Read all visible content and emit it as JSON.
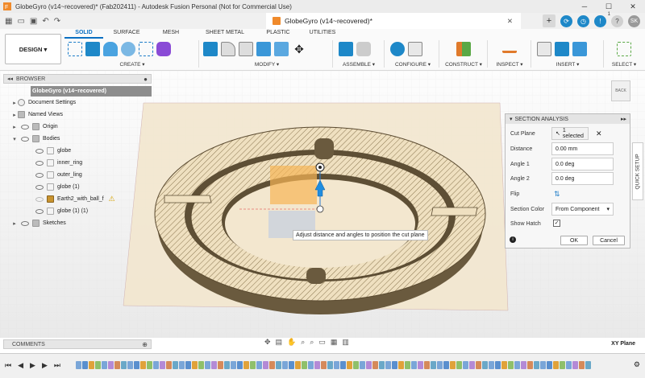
{
  "window": {
    "title": "GlobeGyro (v14~recovered)* (Fab202411) - Autodesk Fusion Personal (Not for Commercial Use)",
    "controls": [
      "─",
      "☐",
      "✕"
    ]
  },
  "doc_tab": {
    "title": "GlobeGyro (v14~recovered)*",
    "close": "✕",
    "add": "+"
  },
  "user": {
    "initials": "SK"
  },
  "notification_count": "1",
  "workspace_button": "DESIGN ▾",
  "ws_tabs": [
    "SOLID",
    "SURFACE",
    "MESH",
    "SHEET METAL",
    "PLASTIC",
    "UTILITIES"
  ],
  "tool_groups": [
    {
      "label": "CREATE ▾"
    },
    {
      "label": "MODIFY ▾"
    },
    {
      "label": "ASSEMBLE ▾"
    },
    {
      "label": "CONFIGURE ▾"
    },
    {
      "label": "CONSTRUCT ▾"
    },
    {
      "label": "INSPECT ▾"
    },
    {
      "label": "INSERT ▾"
    },
    {
      "label": "SELECT ▾"
    }
  ],
  "browser": {
    "header": "BROWSER",
    "root": "GlobeGyro (v14~recovered)",
    "items": [
      {
        "label": "Document Settings"
      },
      {
        "label": "Named Views"
      },
      {
        "label": "Origin"
      },
      {
        "label": "Bodies"
      },
      {
        "label": "globe"
      },
      {
        "label": "inner_ring"
      },
      {
        "label": "outer_ling"
      },
      {
        "label": "globe (1)"
      },
      {
        "label": "Earth2_with_ball_f"
      },
      {
        "label": "globe (1) (1)"
      },
      {
        "label": "Sketches"
      }
    ]
  },
  "section_analysis": {
    "title": "SECTION ANALYSIS",
    "cut_plane_label": "Cut Plane",
    "cut_plane_value": "1 selected",
    "distance_label": "Distance",
    "distance_value": "0.00 mm",
    "angle1_label": "Angle 1",
    "angle1_value": "0.0 deg",
    "angle2_label": "Angle 2",
    "angle2_value": "0.0 deg",
    "flip_label": "Flip",
    "color_label": "Section Color",
    "color_value": "From Component",
    "hatch_label": "Show Hatch",
    "hatch_checked": "✓",
    "ok": "OK",
    "cancel": "Cancel"
  },
  "quick_setup": "QUICK SETUP",
  "tooltip": "Adjust distance and angles to position the cut plane",
  "viewcube_label": "BACK",
  "comments": "COMMENTS",
  "status_plane": "XY Plane",
  "colors": {
    "accent": "#0a6fc2",
    "hatch_fill": "#efe0c0",
    "model_dark": "#6a5a3e",
    "plane": "#f3e7cf"
  }
}
